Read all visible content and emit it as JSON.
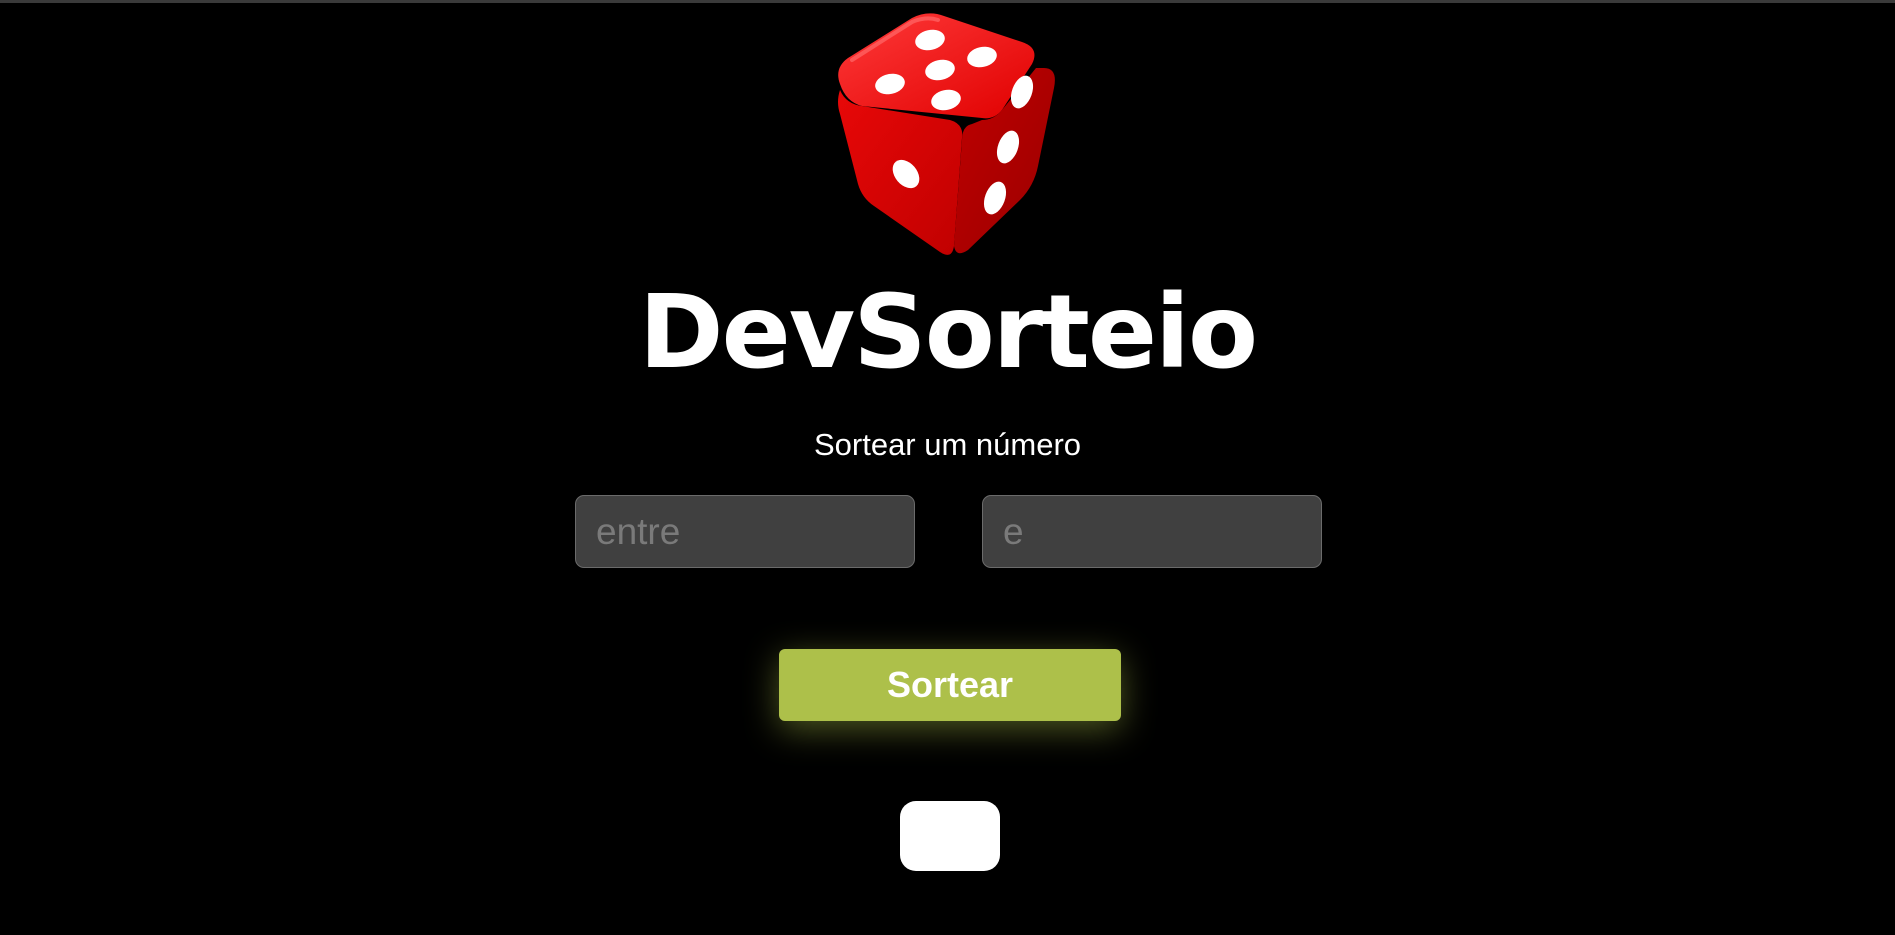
{
  "app": {
    "title": "DevSorteio",
    "subtitle": "Sortear um número"
  },
  "inputs": {
    "min_placeholder": "entre",
    "min_value": "",
    "max_placeholder": "e",
    "max_value": ""
  },
  "actions": {
    "draw_label": "Sortear"
  },
  "result": {
    "value": ""
  },
  "icons": {
    "logo": "dice-icon"
  },
  "colors": {
    "background": "#000000",
    "accent": "#adc04a",
    "dice": "#e10a0a",
    "input_background": "#404040"
  }
}
